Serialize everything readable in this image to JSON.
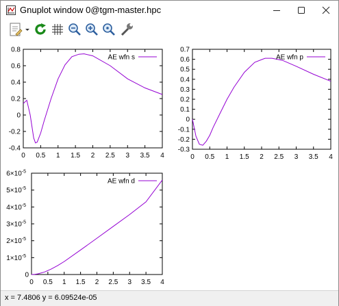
{
  "window": {
    "title": "Gnuplot window 0@tgm-master.hpc"
  },
  "toolbar": {
    "icons": [
      "clipboard-icon",
      "replot-icon",
      "grid-icon",
      "zoom-previous-icon",
      "zoom-next-icon",
      "autoscale-icon",
      "options-icon"
    ]
  },
  "status": {
    "text": "x = 7.4806 y = 6.09524e-05"
  },
  "colors": {
    "curve": "#9400d3",
    "accent": "#008000"
  },
  "chart_data": [
    {
      "type": "line",
      "title": "",
      "xlabel": "",
      "ylabel": "",
      "legend_position": "top-right",
      "xlim": [
        0,
        4
      ],
      "ylim": [
        -0.4,
        0.8
      ],
      "x_ticks": [
        "0",
        "0.5",
        "1",
        "1.5",
        "2",
        "2.5",
        "3",
        "3.5",
        "4"
      ],
      "y_ticks": [
        "-0.4",
        "-0.2",
        "0",
        "0.2",
        "0.4",
        "0.6",
        "0.8"
      ],
      "series": [
        {
          "name": "AE wfn s",
          "x": [
            0,
            0.1,
            0.2,
            0.3,
            0.35,
            0.4,
            0.5,
            0.6,
            0.8,
            1.0,
            1.2,
            1.4,
            1.6,
            1.75,
            2.0,
            2.5,
            3.0,
            3.5,
            4.0
          ],
          "y": [
            0.14,
            0.18,
            0.0,
            -0.28,
            -0.34,
            -0.33,
            -0.22,
            -0.07,
            0.2,
            0.44,
            0.61,
            0.71,
            0.74,
            0.745,
            0.72,
            0.6,
            0.44,
            0.33,
            0.25
          ]
        }
      ]
    },
    {
      "type": "line",
      "title": "",
      "xlabel": "",
      "ylabel": "",
      "legend_position": "top-right",
      "xlim": [
        0,
        4
      ],
      "ylim": [
        -0.3,
        0.7
      ],
      "x_ticks": [
        "0",
        "0.5",
        "1",
        "1.5",
        "2",
        "2.5",
        "3",
        "3.5",
        "4"
      ],
      "y_ticks": [
        "-0.3",
        "-0.2",
        "-0.1",
        "0",
        "0.1",
        "0.2",
        "0.3",
        "0.4",
        "0.5",
        "0.6",
        "0.7"
      ],
      "series": [
        {
          "name": "AE wfn p",
          "x": [
            0,
            0.1,
            0.2,
            0.3,
            0.4,
            0.5,
            0.6,
            0.8,
            1.0,
            1.2,
            1.5,
            1.8,
            2.1,
            2.3,
            2.6,
            3.0,
            3.5,
            4.0
          ],
          "y": [
            0.0,
            -0.17,
            -0.25,
            -0.26,
            -0.22,
            -0.16,
            -0.08,
            0.06,
            0.2,
            0.32,
            0.47,
            0.57,
            0.61,
            0.61,
            0.59,
            0.53,
            0.45,
            0.38
          ]
        }
      ]
    },
    {
      "type": "line",
      "title": "",
      "xlabel": "",
      "ylabel": "",
      "legend_position": "top-right",
      "xlim": [
        0,
        4
      ],
      "ylim": [
        0,
        6e-05
      ],
      "x_ticks": [
        "0",
        "0.5",
        "1",
        "1.5",
        "2",
        "2.5",
        "3",
        "3.5",
        "4"
      ],
      "y_ticks": [
        "0",
        "1×10",
        "2×10",
        "3×10",
        "4×10",
        "5×10",
        "6×10"
      ],
      "y_tick_exponent": "-5",
      "series": [
        {
          "name": "AE wfn d",
          "x": [
            0,
            0.1,
            0.2,
            0.4,
            0.6,
            0.8,
            1.0,
            1.5,
            2.0,
            2.5,
            3.0,
            3.5,
            4.0
          ],
          "y": [
            0,
            1e-07,
            4e-07,
            1.5e-06,
            3.2e-06,
            5.3e-06,
            7.7e-06,
            1.45e-05,
            2.15e-05,
            2.85e-05,
            3.55e-05,
            4.3e-05,
            5.6e-05
          ]
        }
      ]
    }
  ]
}
